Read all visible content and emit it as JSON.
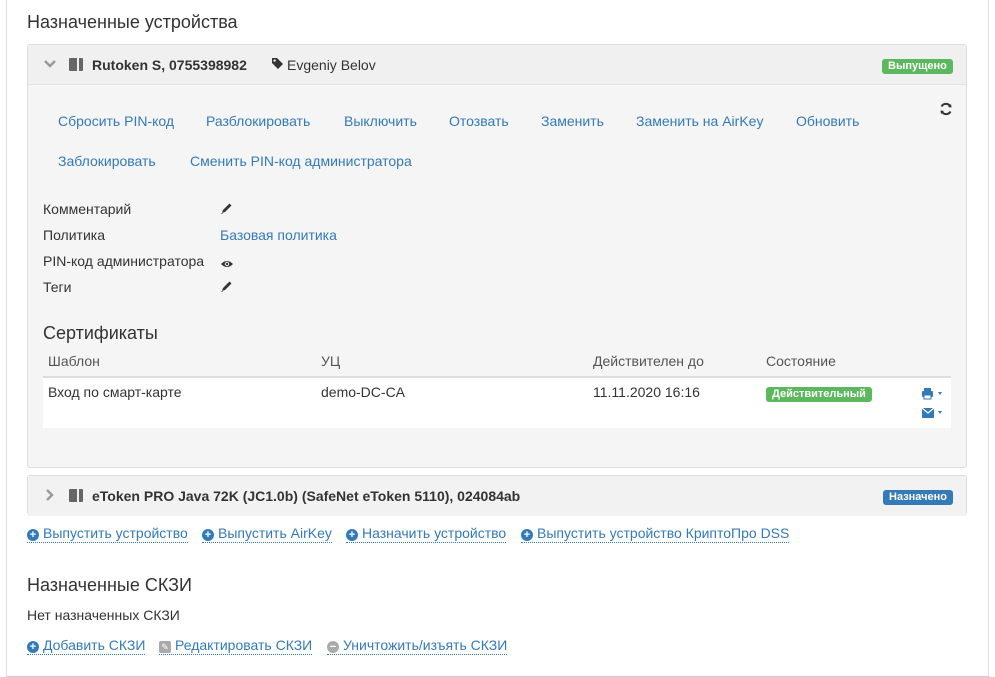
{
  "section_title": "Назначенные устройства",
  "device1": {
    "name": "Rutoken S, 0755398982",
    "owner": "Evgeniy Belov",
    "status": "Выпущено",
    "status_color": "#5cb85c",
    "actions": [
      "Сбросить PIN-код",
      "Разблокировать",
      "Выключить",
      "Отозвать",
      "Заменить",
      "Заменить на AirKey",
      "Обновить",
      "Заблокировать",
      "Сменить PIN-код администратора"
    ],
    "props": {
      "comment_label": "Комментарий",
      "policy_label": "Политика",
      "policy_value": "Базовая политика",
      "admin_pin_label": "PIN-код администратора",
      "tags_label": "Теги"
    },
    "certs": {
      "title": "Сертификаты",
      "columns": [
        "Шаблон",
        "УЦ",
        "Действителен до",
        "Состояние"
      ],
      "rows": [
        {
          "template": "Вход по смарт-карте",
          "ca": "demo-DC-CA",
          "valid_until": "11.11.2020 16:16",
          "state": "Действительный"
        }
      ]
    }
  },
  "device2": {
    "name": "eToken PRO Java 72K (JC1.0b) (SafeNet eToken 5110), 024084ab",
    "status": "Назначено",
    "status_color": "#337ab7"
  },
  "device_links": [
    "Выпустить устройство",
    "Выпустить AirKey",
    "Назначить устройство",
    "Выпустить устройство КриптоПро DSS"
  ],
  "skzi": {
    "title": "Назначенные СКЗИ",
    "empty_text": "Нет назначенных СКЗИ",
    "add": "Добавить СКЗИ",
    "edit": "Редактировать СКЗИ",
    "destroy": "Уничтожить/изъять СКЗИ"
  },
  "icons": {
    "chevron_down": "chevron-down-icon",
    "chevron_right": "chevron-right-icon",
    "device": "device-icon",
    "tag": "tag-icon",
    "refresh": "refresh-icon",
    "pencil": "pencil-icon",
    "eye": "eye-icon",
    "print": "print-icon",
    "envelope": "envelope-icon"
  },
  "accent_color": "#337ab7"
}
